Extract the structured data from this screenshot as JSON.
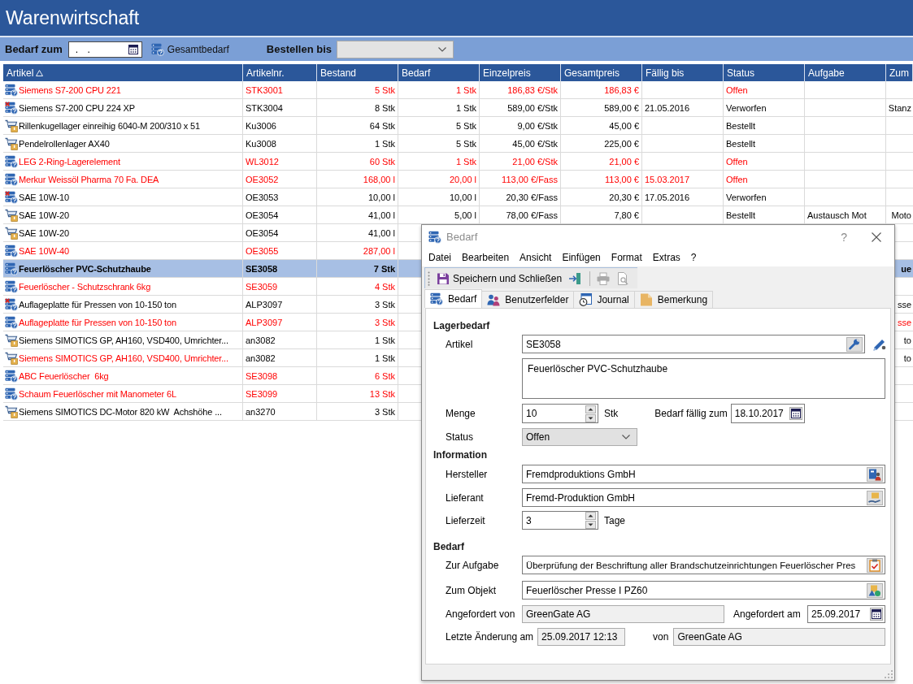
{
  "app": {
    "title": "Warenwirtschaft"
  },
  "filter_bar": {
    "date_label": "Bedarf zum",
    "date_value": ". .",
    "total_button": "Gesamtbedarf",
    "order_label": "Bestellen bis"
  },
  "table": {
    "columns": [
      {
        "label": "Artikel",
        "sorted": true
      },
      {
        "label": "Artikelnr.",
        "sorted": false
      },
      {
        "label": "Bestand",
        "sorted": false
      },
      {
        "label": "Bedarf",
        "sorted": false
      },
      {
        "label": "Einzelpreis",
        "sorted": false
      },
      {
        "label": "Gesamtpreis",
        "sorted": false
      },
      {
        "label": "Fällig bis",
        "sorted": false
      },
      {
        "label": "Status",
        "sorted": false
      },
      {
        "label": "Aufgabe",
        "sorted": false
      },
      {
        "label": "Zum",
        "sorted": false
      }
    ],
    "rows": [
      {
        "kind": "open",
        "selected": false,
        "color": "#ff0000",
        "artikel": {
          "text": "Siemens S7-200 CPU 221",
          "color": "#ff0000"
        },
        "artikelnr": "STK3001",
        "bestand": "5 Stk",
        "bedarf": "1 Stk",
        "einzelpreis": "186,83 €/Stk",
        "gesamtpreis": "186,83 €",
        "status": "Offen"
      },
      {
        "kind": "rejected",
        "selected": false,
        "color": "#000000",
        "artikel": {
          "text": "Siemens S7-200 CPU 224 XP",
          "color": "#000000"
        },
        "artikelnr": "STK3004",
        "bestand": "8 Stk",
        "bedarf": "1 Stk",
        "einzelpreis": "589,00 €/Stk",
        "gesamtpreis": "589,00 €",
        "faellig_bis": "21.05.2016",
        "status": "Verworfen",
        "column_10": "Stanz"
      },
      {
        "kind": "ordered",
        "selected": false,
        "color": "#000000",
        "artikel": {
          "text": "Rillenkugellager einreihig 6040-M 200/310 x 51",
          "color": "#000000"
        },
        "artikelnr": "Ku3006",
        "bestand": "64 Stk",
        "bedarf": "5 Stk",
        "einzelpreis": "9,00 €/Stk",
        "gesamtpreis": "45,00 €",
        "status": "Bestellt"
      },
      {
        "kind": "ordered",
        "selected": false,
        "color": "#000000",
        "artikel": {
          "text": "Pendelrollenlager AX40",
          "color": "#000000"
        },
        "artikelnr": "Ku3008",
        "bestand": "1 Stk",
        "bedarf": "5 Stk",
        "einzelpreis": "45,00 €/Stk",
        "gesamtpreis": "225,00 €",
        "status": "Bestellt"
      },
      {
        "kind": "open",
        "selected": false,
        "color": "#ff0000",
        "artikel": {
          "text": "LEG 2-Ring-Lagerelement",
          "color": "#ff0000"
        },
        "artikelnr": "WL3012",
        "bestand": "60 Stk",
        "bedarf": "1 Stk",
        "einzelpreis": "21,00 €/Stk",
        "gesamtpreis": "21,00 €",
        "status": "Offen"
      },
      {
        "kind": "open",
        "selected": false,
        "color": "#ff0000",
        "artikel": {
          "text": "Merkur Weissöl Pharma 70 Fa. DEA",
          "color": "#ff0000"
        },
        "artikelnr": "OE3052",
        "bestand": "168,00 l",
        "bedarf": "20,00 l",
        "einzelpreis": "113,00 €/Fass",
        "gesamtpreis": "113,00 €",
        "faellig_bis": "15.03.2017",
        "status": "Offen"
      },
      {
        "kind": "rejected",
        "selected": false,
        "color": "#000000",
        "artikel": {
          "text": "SAE 10W-10",
          "color": "#000000"
        },
        "artikelnr": "OE3053",
        "bestand": "10,00 l",
        "bedarf": "10,00 l",
        "einzelpreis": "20,30 €/Fass",
        "gesamtpreis": "20,30 €",
        "faellig_bis": "17.05.2016",
        "status": "Verworfen"
      },
      {
        "kind": "ordered",
        "selected": false,
        "color": "#000000",
        "artikel": {
          "text": "SAE 10W-20",
          "color": "#000000"
        },
        "artikelnr": "OE3054",
        "bestand": "41,00 l",
        "bedarf": "5,00 l",
        "einzelpreis": "78,00 €/Fass",
        "gesamtpreis": "7,80 €",
        "status": "Bestellt",
        "aufgabe": "Austausch Mot",
        "column_10": "Moto"
      },
      {
        "kind": "ordered",
        "selected": false,
        "color": "#000000",
        "artikel": {
          "text": "SAE 10W-20",
          "color": "#000000"
        },
        "artikelnr": "OE3054",
        "bestand": "41,00 l"
      },
      {
        "kind": "open",
        "selected": false,
        "color": "#ff0000",
        "artikel": {
          "text": "SAE 10W-40",
          "color": "#ff0000"
        },
        "artikelnr": "OE3055",
        "bestand": "287,00 l"
      },
      {
        "kind": "open",
        "selected": true,
        "color": "#000000",
        "artikel": {
          "text": "Feuerlöscher PVC-Schutzhaube",
          "color": "#000000"
        },
        "artikelnr": "SE3058",
        "bestand": "7 Stk",
        "column_10": "ue"
      },
      {
        "kind": "open",
        "selected": false,
        "color": "#ff0000",
        "artikel": {
          "text": "Feuerlöscher - Schutzschrank 6kg",
          "color": "#ff0000"
        },
        "artikelnr": "SE3059",
        "bestand": "4 Stk"
      },
      {
        "kind": "rejected",
        "selected": false,
        "color": "#000000",
        "artikel": {
          "text": "Auflageplatte für Pressen von 10-150 ton",
          "color": "#000000"
        },
        "artikelnr": "ALP3097",
        "bestand": "3 Stk",
        "column_10": "sse"
      },
      {
        "kind": "open",
        "selected": false,
        "color": "#ff0000",
        "artikel": {
          "text": "Auflageplatte für Pressen von 10-150 ton",
          "color": "#ff0000"
        },
        "artikelnr": "ALP3097",
        "bestand": "3 Stk",
        "column_10": "sse"
      },
      {
        "kind": "ordered",
        "selected": false,
        "color": "#000000",
        "artikel": {
          "text": "Siemens SIMOTICS GP, AH160, VSD400, Umrichter...",
          "color": "#000000"
        },
        "artikelnr": "an3082",
        "bestand": "1 Stk",
        "column_10": "to"
      },
      {
        "kind": "ordered",
        "selected": false,
        "color": "#000000",
        "artikel": {
          "text": "Siemens SIMOTICS GP, AH160, VSD400, Umrichter...",
          "color": "#ff0000"
        },
        "artikelnr": "an3082",
        "bestand": "1 Stk",
        "column_10": "to"
      },
      {
        "kind": "open",
        "selected": false,
        "color": "#ff0000",
        "artikel": {
          "text": "ABC Feuerlöscher  6kg",
          "color": "#ff0000"
        },
        "artikelnr": "SE3098",
        "bestand": "6 Stk"
      },
      {
        "kind": "open",
        "selected": false,
        "color": "#ff0000",
        "artikel": {
          "text": "Schaum Feuerlöscher mit Manometer 6L",
          "color": "#ff0000"
        },
        "artikelnr": "SE3099",
        "bestand": "13 Stk"
      },
      {
        "kind": "ordered",
        "selected": false,
        "color": "#000000",
        "artikel": {
          "text": "Siemens SIMOTICS DC-Motor 820 kW  Achshöhe ...",
          "color": "#000000"
        },
        "artikelnr": "an3270",
        "bestand": "3 Stk"
      }
    ]
  },
  "dialog": {
    "title": "Bedarf",
    "help": "?",
    "menu": [
      "Datei",
      "Bearbeiten",
      "Ansicht",
      "Einfügen",
      "Format",
      "Extras",
      "?"
    ],
    "toolbar": {
      "save": "Speichern und Schließen",
      "buttons": [
        {
          "kind": "exit",
          "disabled": false
        },
        {
          "kind": "print",
          "disabled": true
        },
        {
          "kind": "preview",
          "disabled": true
        }
      ]
    },
    "tabs": [
      {
        "label": "Bedarf",
        "selected": true
      },
      {
        "label": "Benutzerfelder",
        "selected": false
      },
      {
        "label": "Journal",
        "selected": false
      },
      {
        "label": "Bemerkung",
        "selected": false
      }
    ],
    "lagerbedarf": {
      "heading": "Lagerbedarf",
      "artikel": {
        "label": "Artikel",
        "value": "SE3058"
      },
      "description": "Feuerlöscher PVC-Schutzhaube",
      "menge": {
        "label": "Menge",
        "value": "10",
        "unit": "Stk"
      },
      "faellig": {
        "label": "Bedarf fällig zum",
        "value": "18.10.2017"
      },
      "status": {
        "label": "Status",
        "value": "Offen"
      }
    },
    "information": {
      "heading": "Information",
      "hersteller": {
        "label": "Hersteller",
        "value": "Fremdproduktions GmbH"
      },
      "lieferant": {
        "label": "Lieferant",
        "value": "Fremd-Produktion GmbH"
      },
      "lieferzeit": {
        "label": "Lieferzeit",
        "value": "3",
        "unit": "Tage"
      }
    },
    "bedarf": {
      "heading": "Bedarf",
      "aufgabe": {
        "label": "Zur Aufgabe",
        "value": "Überprüfung der Beschriftung aller Brandschutzeinrichtungen Feuerlöscher Pres"
      },
      "objekt": {
        "label": "Zum Objekt",
        "value": "Feuerlöscher Presse I PZ60"
      },
      "angefordert_von": {
        "label": "Angefordert von",
        "value": "GreenGate AG",
        "readonly": true
      },
      "angefordert_am": {
        "label": "Angefordert am",
        "value": "25.09.2017"
      },
      "geaendert_am": {
        "label": "Letzte Änderung am",
        "value": "25.09.2017 12:13",
        "readonly": true
      },
      "geaendert_von": {
        "label": "von",
        "value": "GreenGate AG",
        "readonly": true
      }
    }
  }
}
